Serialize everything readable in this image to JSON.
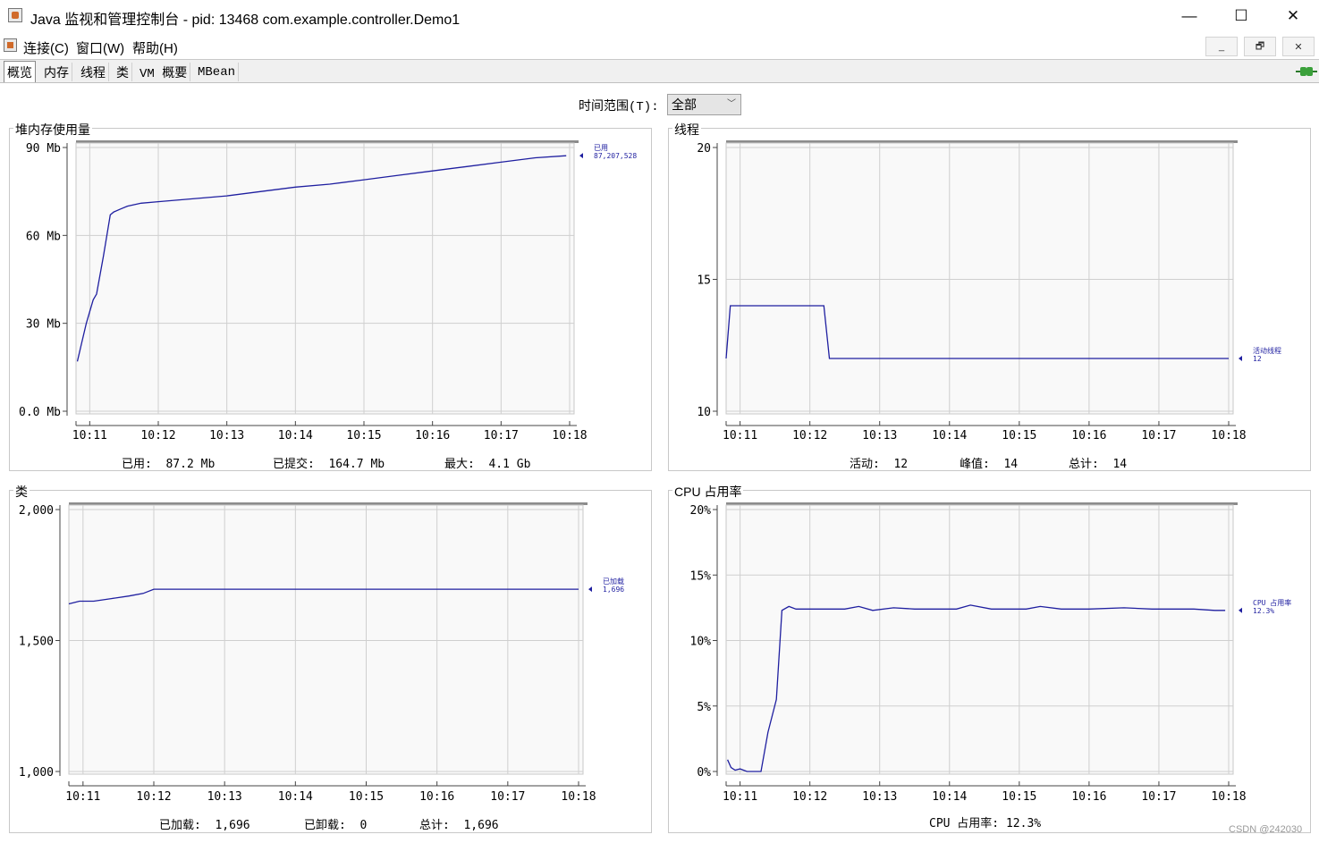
{
  "window": {
    "title": "Java 监视和管理控制台 - pid: 13468 com.example.controller.Demo1",
    "minimize": "—",
    "maximize": "☐",
    "close": "✕"
  },
  "menubar": {
    "items": [
      "连接(C)",
      "窗口(W)",
      "帮助(H)"
    ],
    "mdi": {
      "minimize": "_",
      "restore": "🗗",
      "close": "✕"
    }
  },
  "tabs": [
    {
      "label": "概览",
      "active": true
    },
    {
      "label": "内存",
      "active": false
    },
    {
      "label": "线程",
      "active": false
    },
    {
      "label": "类",
      "active": false
    },
    {
      "label": "VM 概要",
      "active": false
    },
    {
      "label": "MBean",
      "active": false
    }
  ],
  "time_range": {
    "label": "时间范围(T):",
    "value": "全部"
  },
  "watermark": "CSDN @242030",
  "panels": {
    "heap": {
      "title": "堆内存使用量",
      "stats": [
        {
          "label": "已用:",
          "value": "87.2  Mb"
        },
        {
          "label": "已提交:",
          "value": "164.7  Mb"
        },
        {
          "label": "最大:",
          "value": "4.1  Gb"
        }
      ],
      "legend": {
        "name": "已用",
        "value": "87,207,528"
      }
    },
    "threads": {
      "title": "线程",
      "stats": [
        {
          "label": "活动:",
          "value": "12"
        },
        {
          "label": "峰值:",
          "value": "14"
        },
        {
          "label": "总计:",
          "value": "14"
        }
      ],
      "legend": {
        "name": "活动线程",
        "value": "12"
      }
    },
    "classes": {
      "title": "类",
      "stats": [
        {
          "label": "已加载:",
          "value": "1,696"
        },
        {
          "label": "已卸载:",
          "value": "0"
        },
        {
          "label": "总计:",
          "value": "1,696"
        }
      ],
      "legend": {
        "name": "已加载",
        "value": "1,696"
      }
    },
    "cpu": {
      "title": "CPU 占用率",
      "stats": [
        {
          "label": "CPU 占用率:",
          "value": "12.3%"
        }
      ],
      "legend": {
        "name": "CPU 占用率",
        "value": "12.3%"
      }
    }
  },
  "chart_data": [
    {
      "id": "heap",
      "type": "line",
      "title": "堆内存使用量",
      "x_ticks": [
        "10:11",
        "10:12",
        "10:13",
        "10:14",
        "10:15",
        "10:16",
        "10:17",
        "10:18"
      ],
      "y_ticks": [
        "0.0 Mb",
        "30 Mb",
        "60 Mb",
        "90 Mb"
      ],
      "y_tick_values": [
        0,
        30,
        60,
        90
      ],
      "ylim": [
        0,
        90
      ],
      "xlim": [
        10.8,
        18.0
      ],
      "line_color": "#1f1fa0",
      "series": [
        {
          "name": "已用",
          "x": [
            10.82,
            10.88,
            10.95,
            11.05,
            11.1,
            11.2,
            11.3,
            11.35,
            11.45,
            11.55,
            11.75,
            12.0,
            12.5,
            13.0,
            13.5,
            14.0,
            14.5,
            15.0,
            15.5,
            16.0,
            16.5,
            17.0,
            17.5,
            17.95
          ],
          "y": [
            17,
            23,
            30,
            38,
            40,
            53,
            67,
            68,
            69,
            70,
            71,
            71.5,
            72.5,
            73.5,
            75,
            76.5,
            77.5,
            79,
            80.5,
            82,
            83.5,
            85,
            86.5,
            87.2
          ]
        }
      ]
    },
    {
      "id": "threads",
      "type": "line",
      "title": "线程",
      "x_ticks": [
        "10:11",
        "10:12",
        "10:13",
        "10:14",
        "10:15",
        "10:16",
        "10:17",
        "10:18"
      ],
      "y_ticks": [
        "10",
        "15",
        "20"
      ],
      "y_tick_values": [
        10,
        15,
        20
      ],
      "ylim": [
        10,
        20
      ],
      "xlim": [
        10.8,
        18.0
      ],
      "line_color": "#1f1fa0",
      "series": [
        {
          "name": "活动线程",
          "x": [
            10.8,
            10.86,
            12.2,
            12.28,
            18.0
          ],
          "y": [
            12,
            14,
            14,
            12,
            12
          ]
        }
      ]
    },
    {
      "id": "classes",
      "type": "line",
      "title": "类",
      "x_ticks": [
        "10:11",
        "10:12",
        "10:13",
        "10:14",
        "10:15",
        "10:16",
        "10:17",
        "10:18"
      ],
      "y_ticks": [
        "1,000",
        "1,500",
        "2,000"
      ],
      "y_tick_values": [
        1000,
        1500,
        2000
      ],
      "ylim": [
        1000,
        2000
      ],
      "xlim": [
        10.8,
        18.0
      ],
      "line_color": "#1f1fa0",
      "series": [
        {
          "name": "已加载",
          "x": [
            10.8,
            10.95,
            11.15,
            11.4,
            11.65,
            11.85,
            12.0,
            18.0
          ],
          "y": [
            1640,
            1650,
            1650,
            1660,
            1670,
            1680,
            1696,
            1696
          ]
        }
      ]
    },
    {
      "id": "cpu",
      "type": "line",
      "title": "CPU 占用率",
      "x_ticks": [
        "10:11",
        "10:12",
        "10:13",
        "10:14",
        "10:15",
        "10:16",
        "10:17",
        "10:18"
      ],
      "y_ticks": [
        "0%",
        "5%",
        "10%",
        "15%",
        "20%"
      ],
      "y_tick_values": [
        0,
        5,
        10,
        15,
        20
      ],
      "ylim": [
        0,
        20
      ],
      "xlim": [
        10.8,
        18.0
      ],
      "line_color": "#1f1fa0",
      "series": [
        {
          "name": "CPU 占用率",
          "x": [
            10.82,
            10.87,
            10.93,
            11.0,
            11.1,
            11.3,
            11.4,
            11.52,
            11.6,
            11.7,
            11.8,
            12.0,
            12.5,
            12.7,
            12.9,
            13.2,
            13.5,
            13.9,
            14.1,
            14.3,
            14.6,
            14.9,
            15.1,
            15.3,
            15.6,
            16.0,
            16.5,
            16.9,
            17.2,
            17.5,
            17.8,
            17.95
          ],
          "y": [
            0.9,
            0.3,
            0.1,
            0.2,
            0.0,
            0.0,
            3.0,
            5.5,
            12.3,
            12.6,
            12.4,
            12.4,
            12.4,
            12.6,
            12.3,
            12.5,
            12.4,
            12.4,
            12.4,
            12.7,
            12.4,
            12.4,
            12.4,
            12.6,
            12.4,
            12.4,
            12.5,
            12.4,
            12.4,
            12.4,
            12.3,
            12.3
          ]
        }
      ]
    }
  ]
}
